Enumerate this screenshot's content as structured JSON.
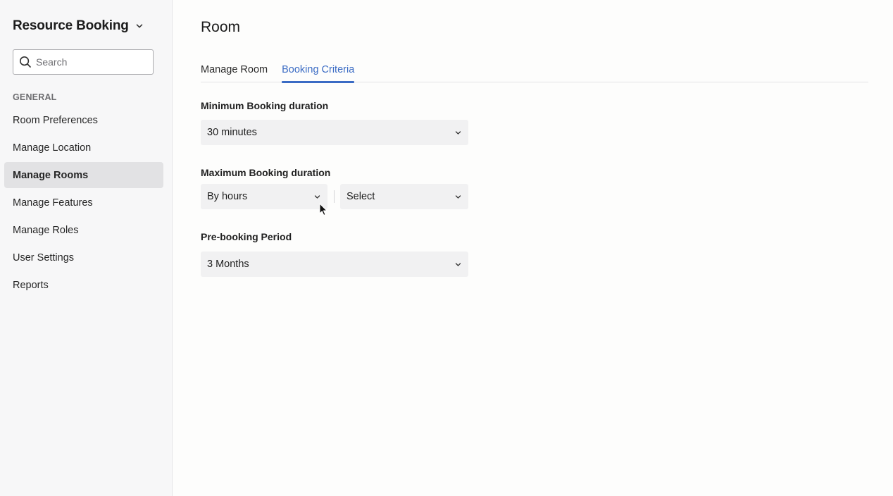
{
  "sidebar": {
    "app_title": "Resource Booking",
    "search": {
      "placeholder": "Search",
      "value": ""
    },
    "section_label": "GENERAL",
    "items": [
      {
        "label": "Room Preferences"
      },
      {
        "label": "Manage Location"
      },
      {
        "label": "Manage Rooms"
      },
      {
        "label": "Manage Features"
      },
      {
        "label": "Manage Roles"
      },
      {
        "label": "User Settings"
      },
      {
        "label": "Reports"
      }
    ],
    "active_item": "Manage Rooms"
  },
  "main": {
    "title": "Room",
    "tabs": [
      {
        "label": "Manage Room"
      },
      {
        "label": "Booking Criteria"
      }
    ],
    "active_tab": "Booking Criteria",
    "fields": {
      "min_duration": {
        "label": "Minimum Booking duration",
        "value": "30 minutes"
      },
      "max_duration": {
        "label": "Maximum Booking duration",
        "unit_value": "By hours",
        "amount_value": "Select"
      },
      "pre_booking": {
        "label": "Pre-booking Period",
        "value": "3 Months"
      }
    }
  },
  "colors": {
    "accent": "#3a6bc4",
    "sidebar_bg": "#f7f7f8",
    "active_item_bg": "#e2e2e4",
    "select_bg": "#f1f1f2"
  },
  "icons": {
    "app_chevron": "chevron-down-icon",
    "search": "search-icon",
    "select_chevron": "chevron-down-icon",
    "cursor": "mouse-pointer-icon"
  }
}
